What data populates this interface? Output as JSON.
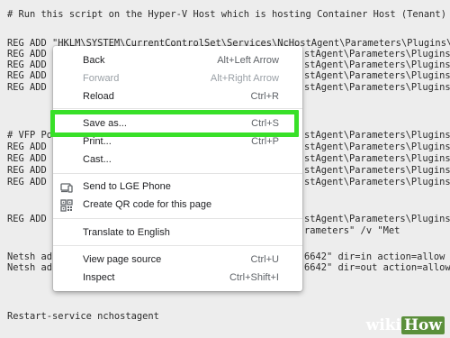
{
  "background_code": {
    "lines": [
      "# Run this script on the Hyper-V Host which is hosting Container Host (Tenant)",
      "REG ADD \"HKLM\\SYSTEM\\CurrentControlSet\\Services\\NcHostAgent\\Parameters\\Plugins\\",
      "REG ADD",
      "REG ADD",
      "REG ADD",
      "REG ADD",
      "# VFP Po",
      "REG ADD",
      "REG ADD",
      "REG ADD",
      "REG ADD",
      "REG ADD",
      "Netsh ad",
      "Netsh ad",
      "Restart-service nchostagent"
    ],
    "right_fragments": [
      "stAgent\\Parameters\\Plugins\\",
      "stAgent\\Parameters\\Plugins\\",
      "stAgent\\Parameters\\Plugins\\",
      "stAgent\\Parameters\\Plugins\\",
      "stAgent\\Parameters\\Plugins\\",
      "stAgent\\Parameters\\Plugins\\",
      "stAgent\\Parameters\\Plugins\\",
      "stAgent\\Parameters\\Plugins\\",
      "stAgent\\Parameters\\Plugins\\",
      "stAgent\\Parameters\\Plugins\\",
      "rameters\" /v \"Met",
      "6642\" dir=in action=allow p",
      "6642\" dir=out action=allow p"
    ]
  },
  "context_menu": {
    "items": [
      {
        "label": "Back",
        "shortcut": "Alt+Left Arrow",
        "disabled": false
      },
      {
        "label": "Forward",
        "shortcut": "Alt+Right Arrow",
        "disabled": true
      },
      {
        "label": "Reload",
        "shortcut": "Ctrl+R",
        "disabled": false
      },
      {
        "label": "Save as...",
        "shortcut": "Ctrl+S",
        "disabled": false,
        "highlighted": true
      },
      {
        "label": "Print...",
        "shortcut": "Ctrl+P",
        "disabled": false
      },
      {
        "label": "Cast...",
        "shortcut": "",
        "disabled": false
      },
      {
        "label": "Send to LGE Phone",
        "shortcut": "",
        "icon": "device-icon"
      },
      {
        "label": "Create QR code for this page",
        "shortcut": "",
        "icon": "qr-code-icon"
      },
      {
        "label": "Translate to English",
        "shortcut": ""
      },
      {
        "label": "View page source",
        "shortcut": "Ctrl+U"
      },
      {
        "label": "Inspect",
        "shortcut": "Ctrl+Shift+I"
      }
    ]
  },
  "highlight_color": "#38e028",
  "watermark": {
    "wiki": "wiki",
    "how": "How"
  }
}
